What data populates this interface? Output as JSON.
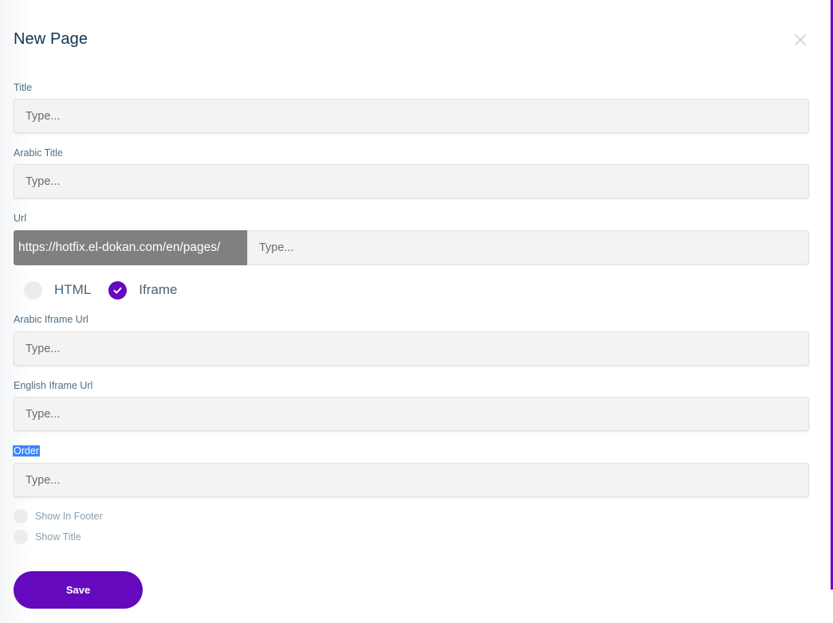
{
  "modal": {
    "title": "New Page",
    "close_icon": "close-icon"
  },
  "colors": {
    "accent": "#6409be",
    "title": "#0d3550",
    "label": "#4f6f83",
    "url_prefix_bg": "#808080",
    "input_bg": "#f3f3f3",
    "selection": "#3a86ff"
  },
  "fields": {
    "title": {
      "label": "Title",
      "placeholder": "Type...",
      "value": ""
    },
    "arabic_title": {
      "label": "Arabic Title",
      "placeholder": "Type...",
      "value": ""
    },
    "url": {
      "label": "Url",
      "prefix": "https://hotfix.el-dokan.com/en/pages/",
      "placeholder": "Type...",
      "value": ""
    },
    "arabic_iframe_url": {
      "label": "Arabic Iframe Url",
      "placeholder": "Type...",
      "value": ""
    },
    "english_iframe_url": {
      "label": "English Iframe Url",
      "placeholder": "Type...",
      "value": ""
    },
    "order": {
      "label": "Order",
      "placeholder": "Type...",
      "value": "",
      "label_selected": true
    }
  },
  "content_type": {
    "options": [
      {
        "label": "HTML",
        "checked": false
      },
      {
        "label": "Iframe",
        "checked": true
      }
    ]
  },
  "toggles": [
    {
      "label": "Show In Footer",
      "checked": false
    },
    {
      "label": "Show Title",
      "checked": false
    }
  ],
  "actions": {
    "save_label": "Save"
  }
}
